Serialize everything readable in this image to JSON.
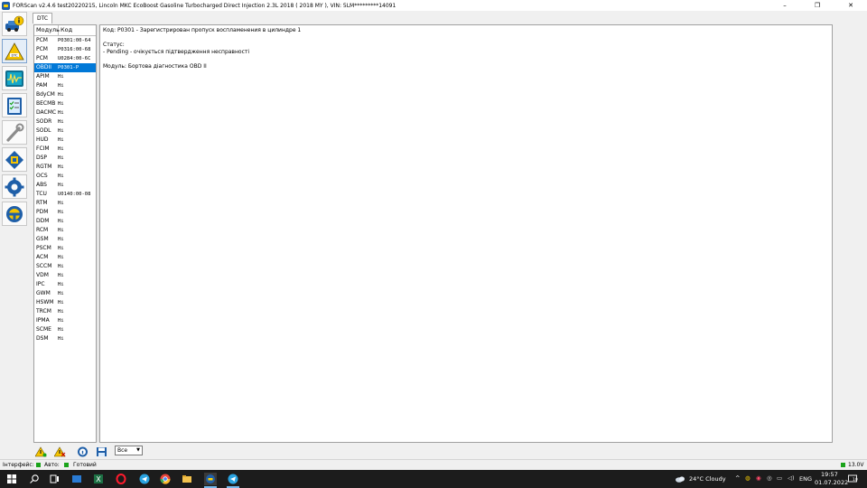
{
  "window": {
    "title": "FORScan v2.4.6 test20220215, Lincoln MKC EcoBoost Gasoline Turbocharged Direct Injection 2.3L 2018 ( 2018 MY ), VIN: 5LM*********14091",
    "minimize": "–",
    "restore": "❐",
    "close": "✕"
  },
  "left_toolbar": [
    {
      "name": "vehicle-info",
      "icon": "car-info-icon"
    },
    {
      "name": "dtc",
      "icon": "dtc-warning-icon",
      "badge": "DTC"
    },
    {
      "name": "oscilloscope",
      "icon": "oscilloscope-icon"
    },
    {
      "name": "tests",
      "icon": "checklist-icon"
    },
    {
      "name": "service",
      "icon": "wrench-icon"
    },
    {
      "name": "chip",
      "icon": "chip-icon"
    },
    {
      "name": "settings",
      "icon": "gear-icon"
    },
    {
      "name": "connection",
      "icon": "steering-icon"
    }
  ],
  "tab": {
    "label": "DTC"
  },
  "module_list": {
    "headers": {
      "module": "Модуль",
      "code": "Код"
    },
    "selected_index": 3,
    "rows": [
      {
        "module": "PCM",
        "code": "P0301:00-64"
      },
      {
        "module": "PCM",
        "code": "P0316:00-68"
      },
      {
        "module": "PCM",
        "code": "U0284:00-6C"
      },
      {
        "module": "OBDII",
        "code": "P0301-P"
      },
      {
        "module": "APIM",
        "code": "Hi"
      },
      {
        "module": "PAM",
        "code": "Hi"
      },
      {
        "module": "BdyCM",
        "code": "Hi"
      },
      {
        "module": "BECMB",
        "code": "Hi"
      },
      {
        "module": "DACMC",
        "code": "Hi"
      },
      {
        "module": "SODR",
        "code": "Hi"
      },
      {
        "module": "SODL",
        "code": "Hi"
      },
      {
        "module": "HUD",
        "code": "Hi"
      },
      {
        "module": "FCIM",
        "code": "Hi"
      },
      {
        "module": "DSP",
        "code": "Hi"
      },
      {
        "module": "RGTM",
        "code": "Hi"
      },
      {
        "module": "OCS",
        "code": "Hi"
      },
      {
        "module": "ABS",
        "code": "Hi"
      },
      {
        "module": "TCU",
        "code": "U0140:00-08"
      },
      {
        "module": "RTM",
        "code": "Hi"
      },
      {
        "module": "PDM",
        "code": "Hi"
      },
      {
        "module": "DDM",
        "code": "Hi"
      },
      {
        "module": "RCM",
        "code": "Hi"
      },
      {
        "module": "GSM",
        "code": "Hi"
      },
      {
        "module": "PSCM",
        "code": "Hi"
      },
      {
        "module": "ACM",
        "code": "Hi"
      },
      {
        "module": "SCCM",
        "code": "Hi"
      },
      {
        "module": "VDM",
        "code": "Hi"
      },
      {
        "module": "IPC",
        "code": "Hi"
      },
      {
        "module": "GWM",
        "code": "Hi"
      },
      {
        "module": "HSWM",
        "code": "Hi"
      },
      {
        "module": "TRCM",
        "code": "Hi"
      },
      {
        "module": "IPMA",
        "code": "Hi"
      },
      {
        "module": "SCME",
        "code": "Hi"
      },
      {
        "module": "DSM",
        "code": "Hi"
      }
    ]
  },
  "detail": {
    "code_line": "Код: P0301 - Зарегистрирован пропуск воспламенения в цилиндре 1",
    "status_label": "Статус:",
    "status_value": " - Pending - очікується підтвердження несправності",
    "module_line": "Модуль: Бортова діагностика OBD II"
  },
  "bottom_toolbar": {
    "buttons": [
      "read-dtc-icon",
      "clear-dtc-icon",
      "info-icon",
      "save-icon"
    ],
    "filter_select": {
      "value": "Все"
    }
  },
  "statusbar": {
    "interface_label": "Інтерфейс:",
    "auto_label": "Авто:",
    "status_text": "Готовий",
    "voltage": "13.0V",
    "indicator_color": "#1aa31a"
  },
  "taskbar": {
    "weather": "24°C  Cloudy",
    "language": "ENG",
    "time": "19:57",
    "date": "01.07.2022",
    "notification_count": "10"
  }
}
